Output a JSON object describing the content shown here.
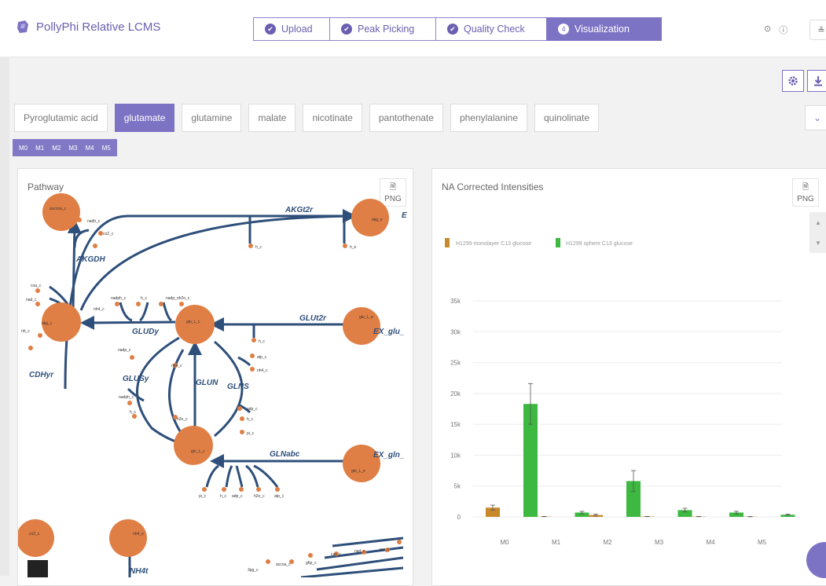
{
  "app": {
    "title": "PollyPhi Relative LCMS",
    "brand_color": "#7d73c4"
  },
  "stepper": {
    "steps": [
      {
        "label": "Upload",
        "done": true
      },
      {
        "label": "Peak Picking",
        "done": true
      },
      {
        "label": "Quality Check",
        "done": true
      },
      {
        "label": "Visualization",
        "number": "4",
        "active": true
      }
    ]
  },
  "header_icons": {
    "icon1": "⊙",
    "icon2": "ⓘ",
    "user": "≗"
  },
  "toolbar": {
    "settings_icon": "gear-icon",
    "download_icon": "download-icon"
  },
  "metabolites": {
    "items": [
      "Pyroglutamic acid",
      "glutamate",
      "glutamine",
      "malate",
      "nicotinate",
      "pantothenate",
      "phenylalanine",
      "quinolinate"
    ],
    "selected": "glutamate"
  },
  "isotopes": [
    "M0",
    "M1",
    "M2",
    "M3",
    "M4",
    "M5"
  ],
  "pathway_panel": {
    "title": "Pathway",
    "png_label": "PNG",
    "reactions": [
      "AKGt2r",
      "AKGDH",
      "GLUDy",
      "GLUt2r",
      "GLUSy",
      "GLUN",
      "GLNS",
      "GLNabc",
      "NH4t"
    ],
    "edge_labels": [
      "EX_glu_",
      "EX_gln_",
      "CDHyr",
      "E"
    ],
    "nodes": [
      "succoa_c",
      "nadh_c",
      "co2_c",
      "akg_e",
      "h_c",
      "h_e",
      "coa_c",
      "nad_c",
      "akg_c",
      "glu_L_c",
      "nadph_c",
      "nadp_c",
      "h_c",
      "nh4_c",
      "nadp_c",
      "atp_c",
      "adp_c",
      "pi_c",
      "h2o_c",
      "gln_L_c",
      "glu_L_e",
      "gln_L_e",
      "pi_c",
      "h_c",
      "adp_c",
      "h2o_c",
      "atp_c",
      "co2_c",
      "nh4_e",
      "g6p_c",
      "cas_c",
      "nad_c",
      "pyr_c",
      "3pg_c",
      "accoa_c"
    ]
  },
  "intensities_panel": {
    "title": "NA Corrected Intensities",
    "png_label": "PNG"
  },
  "chart_data": {
    "type": "bar",
    "categories": [
      "M0",
      "M1",
      "M2",
      "M3",
      "M4",
      "M5"
    ],
    "series": [
      {
        "name": "H1299 monolayer C13 glucose",
        "color": "#c8892a",
        "values": [
          1500,
          50,
          300,
          60,
          50,
          40
        ]
      },
      {
        "name": "H1299 sphere C13 glucose",
        "color": "#3db840",
        "values": [
          18300,
          700,
          5800,
          1100,
          700,
          350
        ]
      }
    ],
    "error_bars": {
      "H1299 monolayer C13 glucose": [
        400,
        20,
        150,
        20,
        20,
        20
      ],
      "H1299 sphere C13 glucose": [
        3300,
        200,
        1700,
        300,
        200,
        100
      ]
    },
    "yticks": [
      "0",
      "5k",
      "10k",
      "15k",
      "20k",
      "25k",
      "30k",
      "35k"
    ],
    "ylim": [
      0,
      35000
    ],
    "legend_position": "top-left",
    "grid": true
  }
}
